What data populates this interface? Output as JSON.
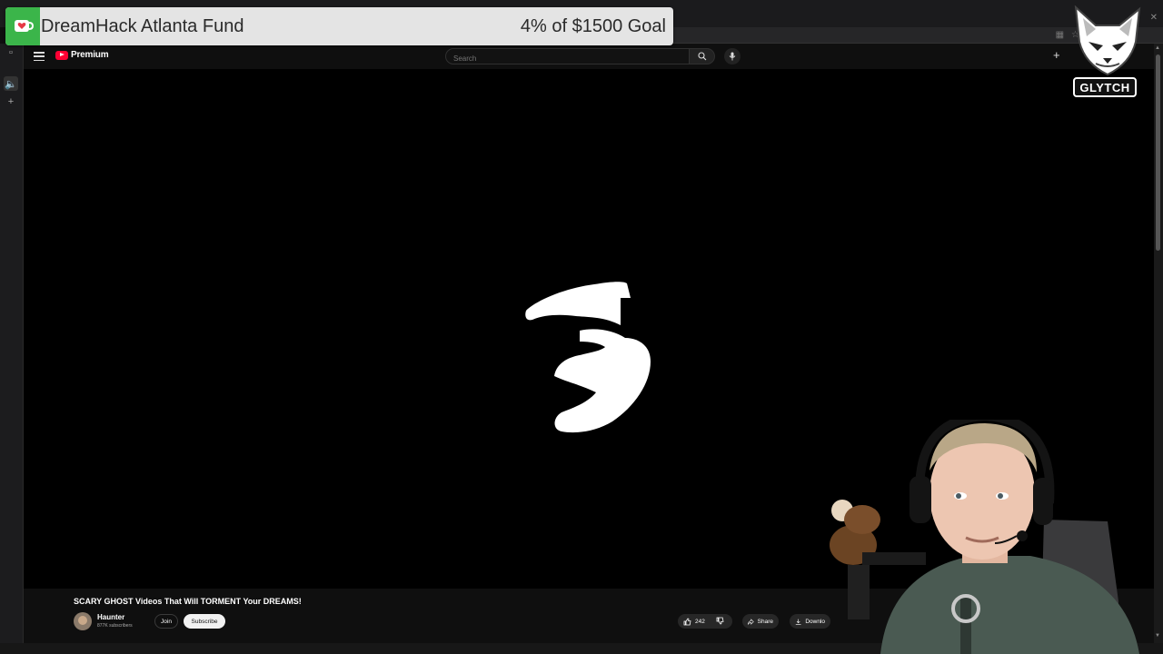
{
  "browser": {
    "tab_icons": [
      "tab-icon",
      "audio-tab-icon",
      "new-tab-icon"
    ],
    "toolbar_icons": [
      "extensions-icon",
      "bookmark-star-icon",
      "profile-icon"
    ]
  },
  "youtube": {
    "brand": "Premium",
    "search": {
      "placeholder": "Search"
    },
    "video": {
      "title": "SCARY GHOST Videos That Will TORMENT Your DREAMS!",
      "channel": "Haunter",
      "subscribers": "877K subscribers",
      "join_label": "Join",
      "subscribe_label": "Subscribe",
      "likes": "242",
      "share_label": "Share",
      "download_label": "Downlo"
    },
    "frame_glyph": "3"
  },
  "overlay": {
    "donation": {
      "title": "DreamHack Atlanta Fund",
      "goal_text": "4% of $1500 Goal",
      "accent": "#3bb54a"
    },
    "logo_label": "GLYTCH"
  }
}
